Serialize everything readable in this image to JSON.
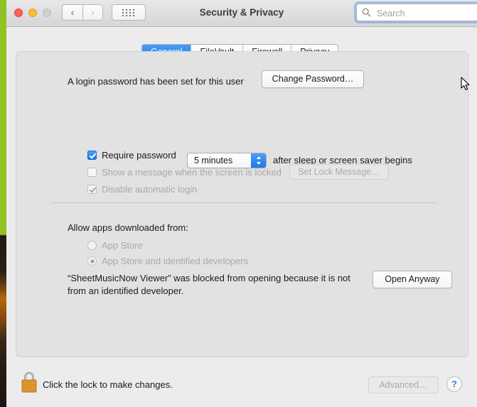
{
  "window": {
    "title": "Security & Privacy",
    "traffic_lights": {
      "close": "close-button",
      "minimize": "minimize-button",
      "zoom": "zoom-button-disabled"
    },
    "nav": {
      "back": "‹",
      "forward": "›"
    },
    "show_all": "show-all-grid"
  },
  "search": {
    "placeholder": "Search",
    "value": ""
  },
  "tabs": [
    {
      "label": "General",
      "active": true
    },
    {
      "label": "FileVault",
      "active": false
    },
    {
      "label": "Firewall",
      "active": false
    },
    {
      "label": "Privacy",
      "active": false
    }
  ],
  "general": {
    "login_password_text": "A login password has been set for this user",
    "change_password_button": "Change Password…",
    "require_password": {
      "label": "Require password",
      "checked": true,
      "interval_value": "5 minutes",
      "suffix_text": "after sleep or screen saver begins"
    },
    "show_message": {
      "label": "Show a message when the screen is locked",
      "checked": false,
      "disabled": true,
      "button_label": "Set Lock Message…"
    },
    "disable_auto_login": {
      "label": "Disable automatic login",
      "checked": true,
      "disabled": true
    },
    "allow_apps_label": "Allow apps downloaded from:",
    "radio_options": [
      {
        "label": "App Store",
        "selected": false,
        "disabled": true
      },
      {
        "label": "App Store and identified developers",
        "selected": true,
        "disabled": true
      }
    ],
    "blocked_message": "“SheetMusicNow Viewer” was blocked from opening because it is not from an identified developer.",
    "open_anyway_button": "Open Anyway"
  },
  "footer": {
    "lock_icon": "closed-padlock-icon",
    "lock_text": "Click the lock to make changes.",
    "advanced_button": "Advanced…",
    "help_button": "?"
  },
  "colors": {
    "accent_blue": "#1b79e8",
    "window_bg": "#ececec",
    "panel_bg": "#e2e2e2",
    "lock_gold": "#e8a33d",
    "desktop_green": "#8fc321"
  }
}
